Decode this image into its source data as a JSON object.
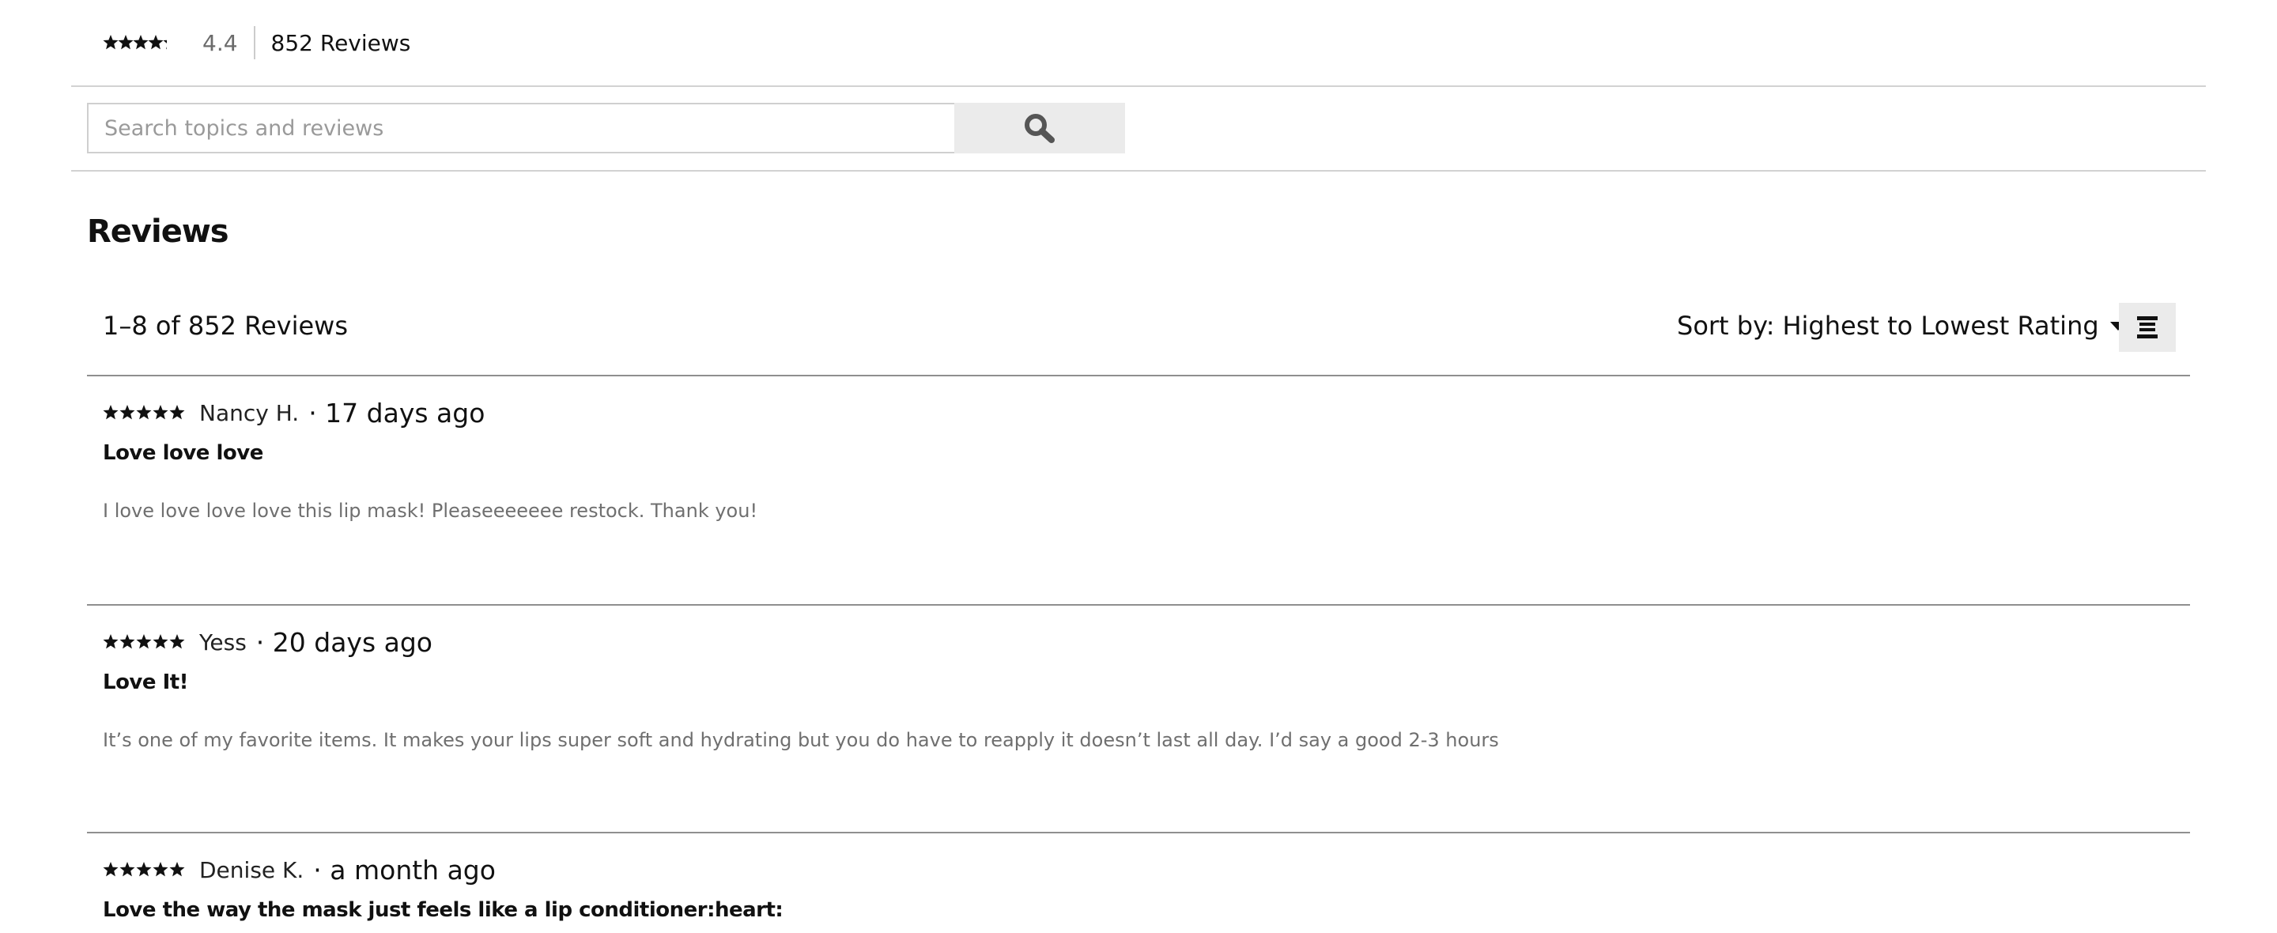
{
  "summary": {
    "rating": 4.4,
    "average_label": "4.4",
    "total_label": "852 Reviews"
  },
  "search": {
    "placeholder": "Search topics and reviews",
    "button_icon": "search-icon"
  },
  "reviews_section": {
    "heading": "Reviews",
    "count_label": "1–8 of 852 Reviews",
    "sort_prefix": "Sort by:",
    "sort_value": "Highest to Lowest Rating",
    "view_toggle_icon": "list-view-icon"
  },
  "reviews": [
    {
      "rating": 5,
      "author": "Nancy H.",
      "date": "· 17 days ago",
      "title": "Love love love",
      "body": "I love love love love this lip mask! Pleaseeeeeee restock. Thank you!"
    },
    {
      "rating": 5,
      "author": "Yess",
      "date": "· 20 days ago",
      "title": "Love It!",
      "body": "It’s one of my favorite items. It makes your lips super soft and hydrating but you do have to reapply it doesn’t last all day. I’d say a good 2-3 hours"
    },
    {
      "rating": 5,
      "author": "Denise K.",
      "date": "· a month ago",
      "title": "Love the way the mask just feels like a lip conditioner:heart:",
      "body": ""
    }
  ]
}
